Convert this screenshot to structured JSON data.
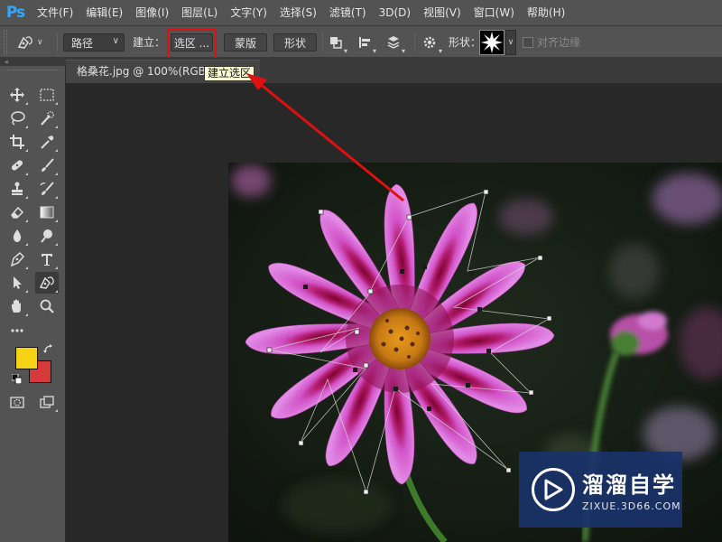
{
  "app": {
    "logo": "Ps"
  },
  "menu": [
    "文件(F)",
    "编辑(E)",
    "图像(I)",
    "图层(L)",
    "文字(Y)",
    "选择(S)",
    "滤镜(T)",
    "3D(D)",
    "视图(V)",
    "窗口(W)",
    "帮助(H)"
  ],
  "options_bar": {
    "tool_icon": "freeform-pen-icon",
    "mode_value": "路径",
    "make_label": "建立：",
    "selection_button": "选区 ...",
    "mask_button": "蒙版",
    "shape_button": "形状",
    "shape_label": "形状：",
    "align_edges_label": "对齐边缘",
    "align_edges_checked": false
  },
  "tooltip": "建立选区",
  "document": {
    "tab_title": "格桑花.jpg @ 100%(RGB/8)"
  },
  "colors": {
    "foreground": "#f5d214",
    "background": "#d63a3a",
    "highlight": "#e01010",
    "arrow": "#e01010"
  },
  "tools": [
    "move-icon",
    "marquee-icon",
    "lasso-icon",
    "quick-select-icon",
    "crop-icon",
    "eyedropper-icon",
    "healing-brush-icon",
    "brush-icon",
    "clone-stamp-icon",
    "history-brush-icon",
    "eraser-icon",
    "gradient-icon",
    "blur-icon",
    "dodge-icon",
    "pen-icon",
    "type-icon",
    "path-select-icon",
    "freeform-pen-icon",
    "hand-icon",
    "zoom-icon",
    "more-tools-icon",
    "default-colors-icon",
    "swap-colors-icon",
    "quick-mask-icon",
    "screen-mode-icon"
  ],
  "watermark": {
    "name": "溜溜自学",
    "url": "ZIXUE.3D66.COM"
  }
}
